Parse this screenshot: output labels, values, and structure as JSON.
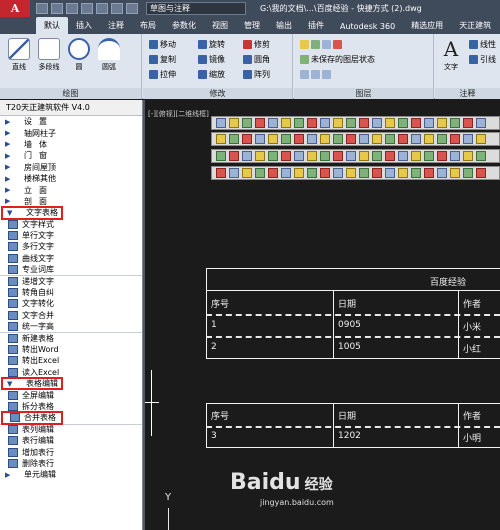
{
  "titlebar": {
    "app_letter": "A",
    "workspace": "草图与注释",
    "document": "G:\\我的文档\\...\\百度经验 - 快捷方式 (2).dwg"
  },
  "tabs": [
    "默认",
    "插入",
    "注释",
    "布局",
    "参数化",
    "视图",
    "管理",
    "输出",
    "插件",
    "Autodesk 360",
    "精选应用",
    "天正建筑"
  ],
  "ribbon": {
    "draw_tools": [
      "直线",
      "多段线",
      "圆",
      "圆弧"
    ],
    "modify_tools": [
      "移动",
      "旋转",
      "修剪",
      "复制",
      "镜像",
      "圆角",
      "拉伸",
      "缩放",
      "阵列"
    ],
    "layer_status": "未保存的图层状态",
    "text_tool": "文字",
    "annot_tools": [
      "线性",
      "引线"
    ],
    "panel_titles": [
      "绘图",
      "修改",
      "图层",
      "注释"
    ]
  },
  "t20": {
    "title": "T20天正建筑软件 V4.0",
    "sections": [
      {
        "label": "设置",
        "type": "head"
      },
      {
        "label": "轴网柱子",
        "type": "head2"
      },
      {
        "label": "墙体",
        "type": "head"
      },
      {
        "label": "门窗",
        "type": "head"
      },
      {
        "label": "房间屋顶",
        "type": "head2"
      },
      {
        "label": "楼梯其他",
        "type": "head2"
      },
      {
        "label": "立面",
        "type": "head"
      },
      {
        "label": "剖面",
        "type": "head"
      },
      {
        "label": "文字表格",
        "type": "head2",
        "highlight": true
      }
    ],
    "text_items": [
      "文字样式",
      "单行文字",
      "多行文字",
      "曲线文字",
      "专业词库"
    ],
    "text_items2": [
      "递增文字",
      "转角自纠",
      "文字转化",
      "文字合并",
      "统一字高"
    ],
    "table_items": [
      "新建表格",
      "转出Word",
      "转出Excel",
      "读入Excel"
    ],
    "table_edit": "表格编辑",
    "table_edit_items": [
      "全屏编辑",
      "拆分表格",
      "合并表格"
    ],
    "row_items": [
      "表列编辑",
      "表行编辑",
      "增加表行",
      "删除表行"
    ],
    "cell_edit": "单元编辑"
  },
  "canvas": {
    "viewport_label": "[-][俯视][二维线框]",
    "table_title": "百度经验",
    "table1": {
      "headers": [
        "序号",
        "日期",
        "作者"
      ],
      "rows": [
        [
          "1",
          "0905",
          "小米"
        ],
        [
          "2",
          "1005",
          "小红"
        ]
      ]
    },
    "table2": {
      "headers": [
        "序号",
        "日期",
        "作者"
      ],
      "rows": [
        [
          "3",
          "1202",
          "小明"
        ]
      ]
    },
    "axis_label": "Y"
  },
  "watermark": {
    "brand": "Baidu",
    "suffix": "经验",
    "site": "jingyan.baidu.com"
  }
}
